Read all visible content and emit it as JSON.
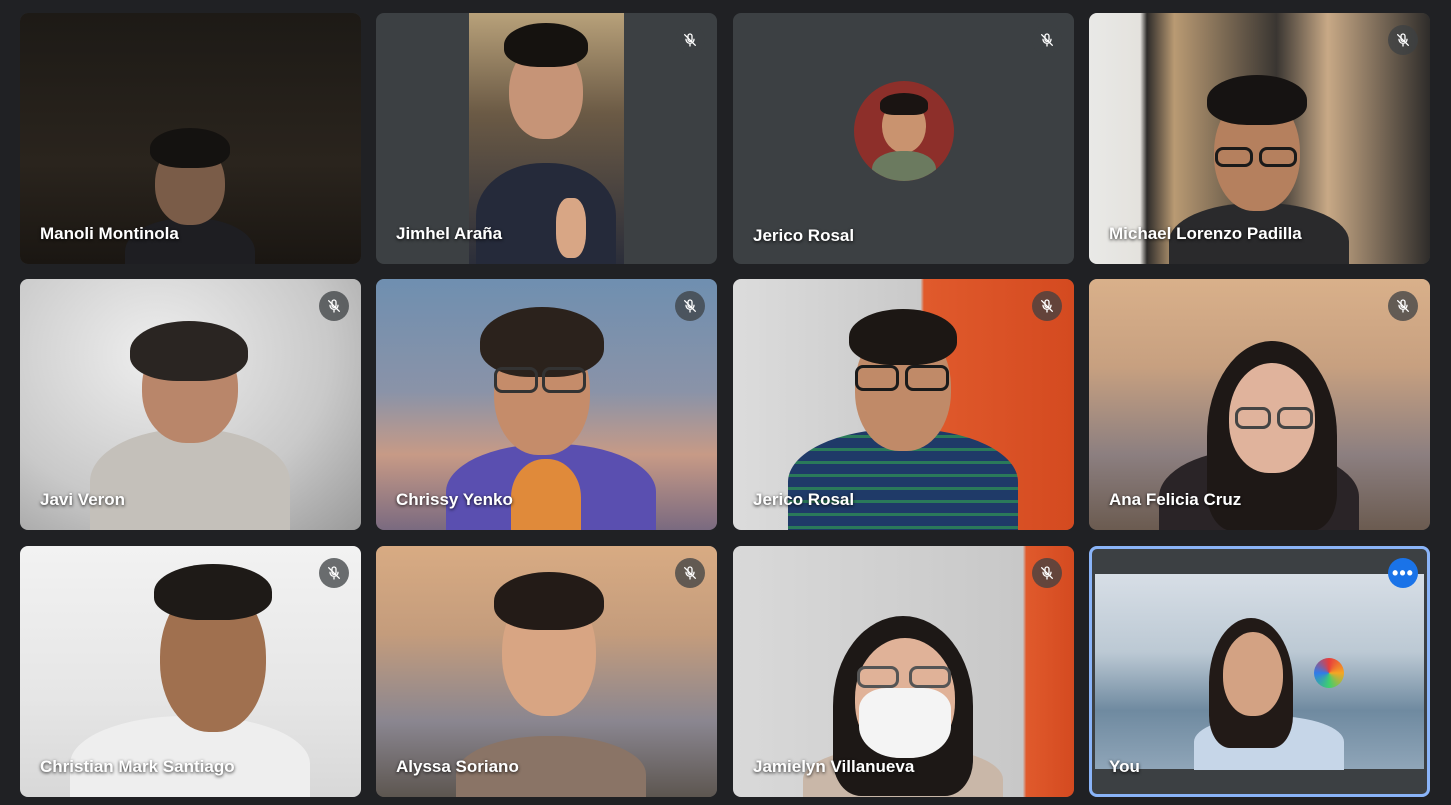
{
  "participants": [
    {
      "name": "Manoli Montinola",
      "muted": false
    },
    {
      "name": "Jimhel Araña",
      "muted": true
    },
    {
      "name": "Jerico Rosal",
      "muted": true
    },
    {
      "name": "Michael Lorenzo Padilla",
      "muted": true
    },
    {
      "name": "Javi Veron",
      "muted": true
    },
    {
      "name": "Chrissy Yenko",
      "muted": true
    },
    {
      "name": "Jerico Rosal",
      "muted": true
    },
    {
      "name": "Ana Felicia Cruz",
      "muted": true
    },
    {
      "name": "Christian Mark Santiago",
      "muted": true
    },
    {
      "name": "Alyssa Soriano",
      "muted": true
    },
    {
      "name": "Jamielyn Villanueva",
      "muted": true
    },
    {
      "name": "You",
      "muted": false,
      "self": true
    }
  ],
  "icons": {
    "muted_mic": "mic-off-icon",
    "more_options": "more-options-icon"
  },
  "colors": {
    "background": "#202124",
    "self_outline": "#8ab4f8",
    "more_button": "#1a73e8"
  }
}
